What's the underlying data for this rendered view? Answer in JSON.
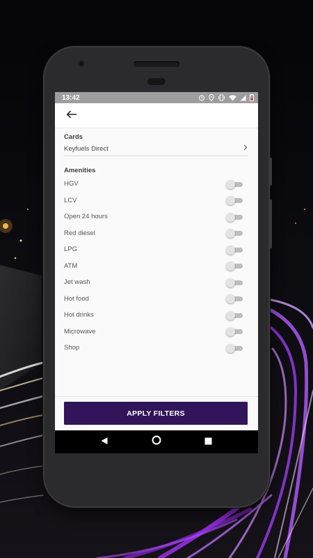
{
  "status_bar": {
    "time": "13:42",
    "icons": [
      "alarm-icon",
      "location-icon",
      "vibrate-icon",
      "wifi-icon",
      "signal-icon",
      "battery-icon"
    ],
    "battery_color": "#e53935"
  },
  "app_bar": {
    "back_icon": "arrow-left-icon"
  },
  "cards": {
    "title": "Cards",
    "selected": "Keyfuels Direct",
    "chevron_icon": "chevron-right-icon"
  },
  "amenities": {
    "title": "Amenities",
    "items": [
      {
        "label": "HGV",
        "enabled": false
      },
      {
        "label": "LCV",
        "enabled": false
      },
      {
        "label": "Open 24 hours",
        "enabled": false
      },
      {
        "label": "Red diesel",
        "enabled": false
      },
      {
        "label": "LPG",
        "enabled": false
      },
      {
        "label": "ATM",
        "enabled": false
      },
      {
        "label": "Jet wash",
        "enabled": false
      },
      {
        "label": "Hot food",
        "enabled": false
      },
      {
        "label": "Hot drinks",
        "enabled": false
      },
      {
        "label": "Microwave",
        "enabled": false
      },
      {
        "label": "Shop",
        "enabled": false
      }
    ]
  },
  "apply_button": {
    "label": "APPLY FILTERS",
    "color": "#32145a"
  },
  "nav_bar": {
    "buttons": [
      "back-triangle-icon",
      "home-circle-icon",
      "recents-square-icon"
    ]
  }
}
